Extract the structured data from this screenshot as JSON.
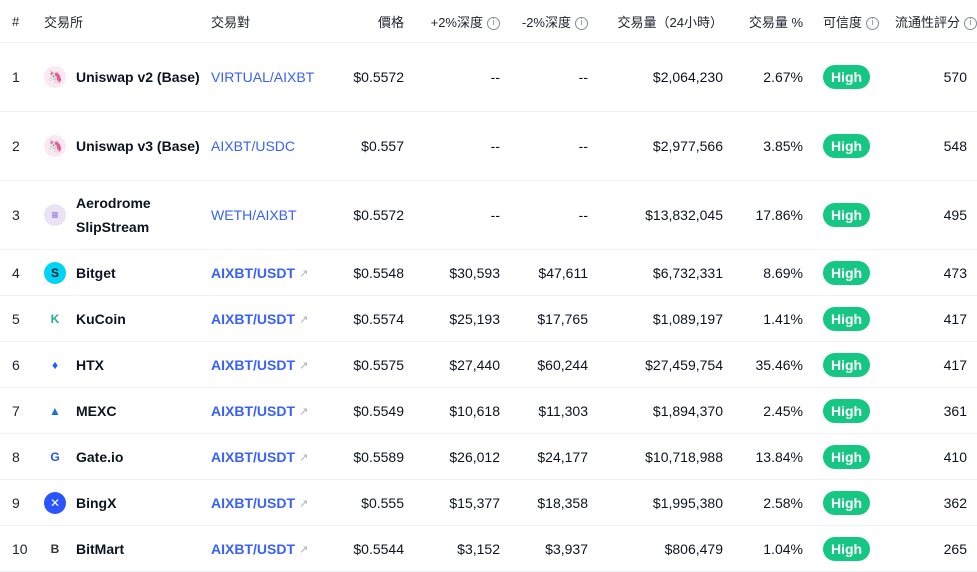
{
  "header": {
    "rank": "#",
    "exchange": "交易所",
    "pair": "交易對",
    "price": "價格",
    "depth_plus": "+2%深度",
    "depth_minus": "-2%深度",
    "volume": "交易量（24小時）",
    "volume_pct": "交易量 %",
    "confidence": "可信度",
    "liquidity": "流通性評分",
    "info_glyph": "i"
  },
  "colors": {
    "link": "#3861fb",
    "badge": "#16c784",
    "border": "#eff2f5"
  },
  "rows": [
    {
      "rank": "1",
      "exchange": "Uniswap v2 (Base)",
      "logo": "uniswap-icon",
      "pair": "VIRTUAL/AIXBT",
      "price": "$0.5572",
      "depth_plus": "--",
      "depth_minus": "--",
      "volume": "$2,064,230",
      "volume_pct": "2.67%",
      "confidence": "High",
      "liquidity": "570"
    },
    {
      "rank": "2",
      "exchange": "Uniswap v3 (Base)",
      "logo": "uniswap-icon",
      "pair": "AIXBT/USDC",
      "price": "$0.557",
      "depth_plus": "--",
      "depth_minus": "--",
      "volume": "$2,977,566",
      "volume_pct": "3.85%",
      "confidence": "High",
      "liquidity": "548"
    },
    {
      "rank": "3",
      "exchange": "Aerodrome SlipStream",
      "logo": "aerodrome-icon",
      "pair": "WETH/AIXBT",
      "price": "$0.5572",
      "depth_plus": "--",
      "depth_minus": "--",
      "volume": "$13,832,045",
      "volume_pct": "17.86%",
      "confidence": "High",
      "liquidity": "495"
    },
    {
      "rank": "4",
      "exchange": "Bitget",
      "logo": "bitget-icon",
      "pair": "AIXBT/USDT",
      "price": "$0.5548",
      "depth_plus": "$30,593",
      "depth_minus": "$47,611",
      "volume": "$6,732,331",
      "volume_pct": "8.69%",
      "confidence": "High",
      "liquidity": "473"
    },
    {
      "rank": "5",
      "exchange": "KuCoin",
      "logo": "kucoin-icon",
      "pair": "AIXBT/USDT",
      "price": "$0.5574",
      "depth_plus": "$25,193",
      "depth_minus": "$17,765",
      "volume": "$1,089,197",
      "volume_pct": "1.41%",
      "confidence": "High",
      "liquidity": "417"
    },
    {
      "rank": "6",
      "exchange": "HTX",
      "logo": "htx-icon",
      "pair": "AIXBT/USDT",
      "price": "$0.5575",
      "depth_plus": "$27,440",
      "depth_minus": "$60,244",
      "volume": "$27,459,754",
      "volume_pct": "35.46%",
      "confidence": "High",
      "liquidity": "417"
    },
    {
      "rank": "7",
      "exchange": "MEXC",
      "logo": "mexc-icon",
      "pair": "AIXBT/USDT",
      "price": "$0.5549",
      "depth_plus": "$10,618",
      "depth_minus": "$11,303",
      "volume": "$1,894,370",
      "volume_pct": "2.45%",
      "confidence": "High",
      "liquidity": "361"
    },
    {
      "rank": "8",
      "exchange": "Gate.io",
      "logo": "gateio-icon",
      "pair": "AIXBT/USDT",
      "price": "$0.5589",
      "depth_plus": "$26,012",
      "depth_minus": "$24,177",
      "volume": "$10,718,988",
      "volume_pct": "13.84%",
      "confidence": "High",
      "liquidity": "410"
    },
    {
      "rank": "9",
      "exchange": "BingX",
      "logo": "bingx-icon",
      "pair": "AIXBT/USDT",
      "price": "$0.555",
      "depth_plus": "$15,377",
      "depth_minus": "$18,358",
      "volume": "$1,995,380",
      "volume_pct": "2.58%",
      "confidence": "High",
      "liquidity": "362"
    },
    {
      "rank": "10",
      "exchange": "BitMart",
      "logo": "bitmart-icon",
      "pair": "AIXBT/USDT",
      "price": "$0.5544",
      "depth_plus": "$3,152",
      "depth_minus": "$3,937",
      "volume": "$806,479",
      "volume_pct": "1.04%",
      "confidence": "High",
      "liquidity": "265"
    }
  ]
}
